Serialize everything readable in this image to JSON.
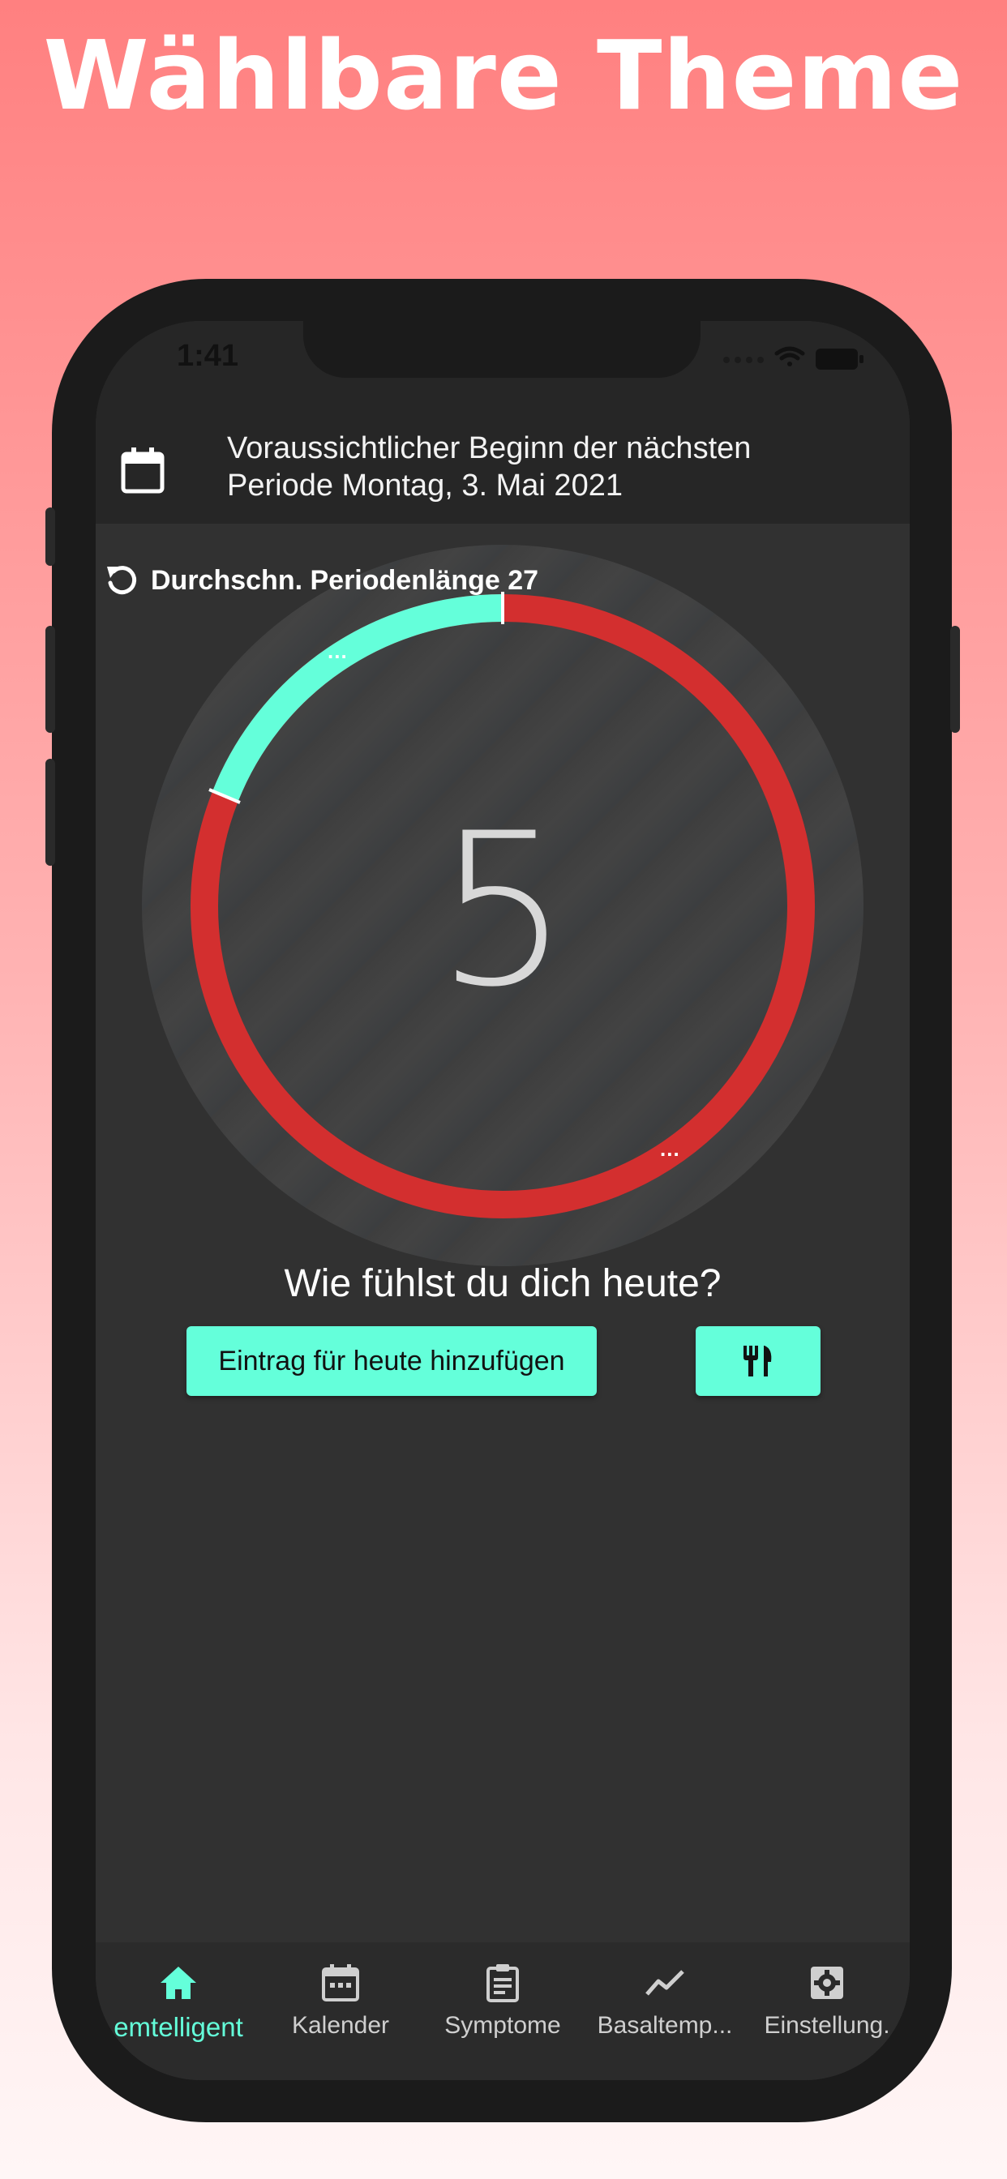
{
  "promo": {
    "headline": "Wählbare Theme"
  },
  "status_bar": {
    "time": "1:41"
  },
  "header": {
    "next_period_line1": "Voraussichtlicher Beginn der nächsten",
    "next_period_line2": "Periode Montag, 3. Mai 2021",
    "calendar_icon": "calendar-icon"
  },
  "cycle": {
    "avg_label": "Durchschn. Periodenlänge 27",
    "day": "5",
    "dots_top": "...",
    "dots_bottom": "..."
  },
  "prompt": {
    "question": "Wie fühlst du dich heute?"
  },
  "actions": {
    "add_entry_label": "Eintrag für heute hinzufügen",
    "diet_icon": "fork-knife-icon"
  },
  "bottom_nav": [
    {
      "label": "emtelligent",
      "icon": "home-icon",
      "active": true
    },
    {
      "label": "Kalender",
      "icon": "calendar-icon",
      "active": false
    },
    {
      "label": "Symptome",
      "icon": "clipboard-icon",
      "active": false
    },
    {
      "label": "Basaltemp...",
      "icon": "trend-icon",
      "active": false
    },
    {
      "label": "Einstellung.",
      "icon": "settings-icon",
      "active": false
    }
  ],
  "colors": {
    "accent": "#64ffda",
    "period": "#d32f2f",
    "background": "#313131"
  }
}
